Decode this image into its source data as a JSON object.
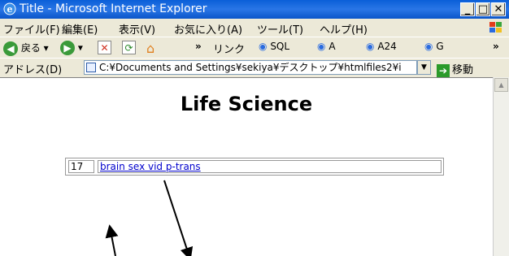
{
  "window": {
    "title": "Title - Microsoft Internet Explorer"
  },
  "menu": [
    "ファイル(F)",
    "編集(E)",
    "表示(V)",
    "お気に入り(A)",
    "ツール(T)",
    "ヘルプ(H)"
  ],
  "toolbar": {
    "back_label": "戻る",
    "links_label": "リンク",
    "links": [
      "SQL",
      "A",
      "A24",
      "G"
    ]
  },
  "address": {
    "label": "アドレス(D)",
    "value": "C:¥Documents and Settings¥sekiya¥デスクトップ¥htmlfiles2¥i",
    "go_label": "移動"
  },
  "page": {
    "heading": "Life Science",
    "row": {
      "number": "17",
      "link_text": "brain sex vid p-trans"
    }
  },
  "icons": [
    "ie-icon",
    "minimize-icon",
    "maximize-icon",
    "close-icon",
    "windows-logo-icon",
    "back-icon",
    "forward-icon",
    "stop-icon",
    "refresh-icon",
    "home-icon",
    "page-icon",
    "go-icon"
  ]
}
